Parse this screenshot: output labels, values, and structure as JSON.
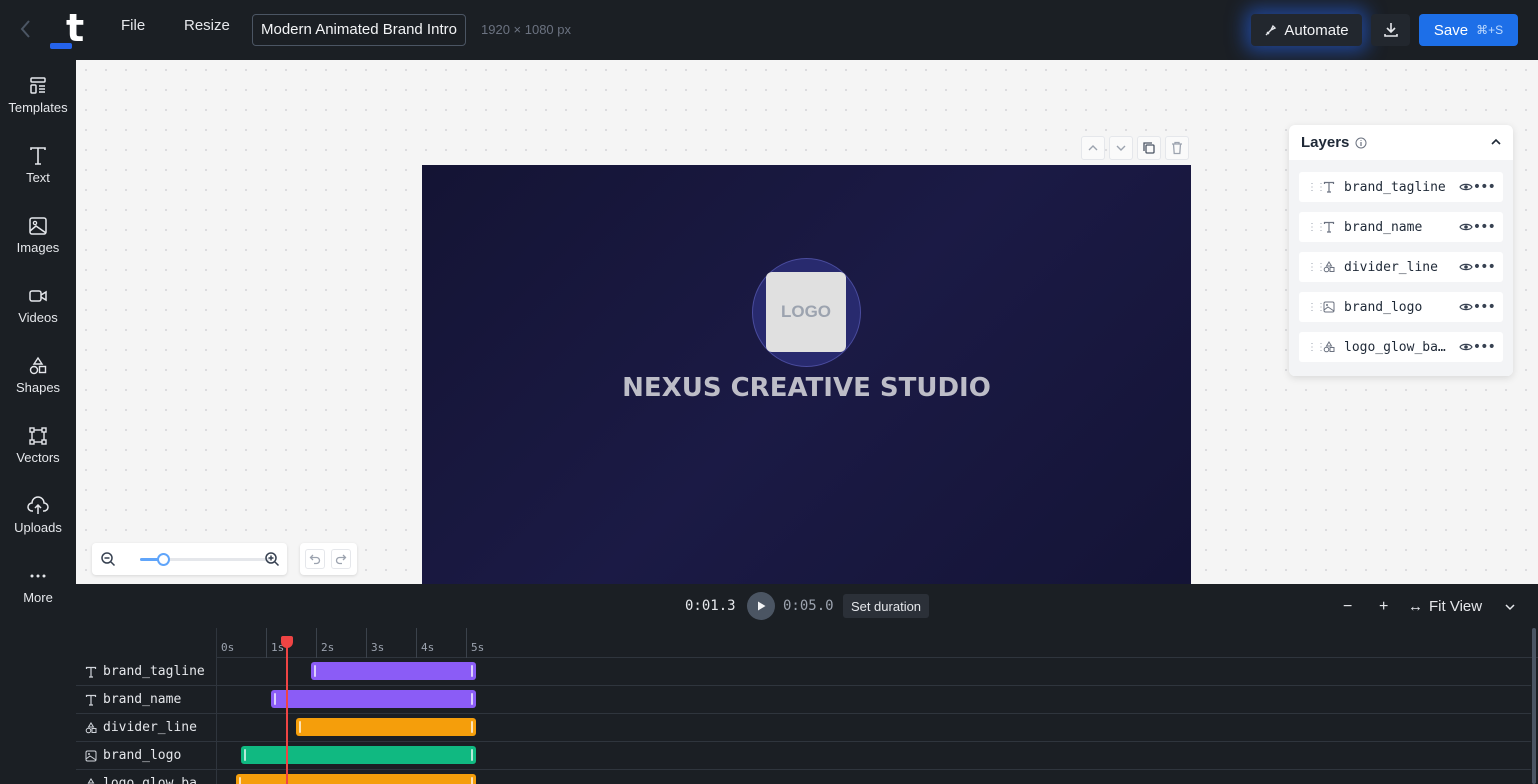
{
  "header": {
    "menu": {
      "file": "File",
      "resize": "Resize"
    },
    "project_title": "Modern Animated Brand Intro",
    "dimensions": "1920 × 1080 px",
    "automate_label": "Automate",
    "save_label": "Save",
    "save_shortcut": "⌘+S"
  },
  "sidebar": {
    "items": [
      {
        "label": "Templates",
        "icon": "templates-icon"
      },
      {
        "label": "Text",
        "icon": "text-icon"
      },
      {
        "label": "Images",
        "icon": "image-icon"
      },
      {
        "label": "Videos",
        "icon": "video-icon"
      },
      {
        "label": "Shapes",
        "icon": "shapes-icon"
      },
      {
        "label": "Vectors",
        "icon": "vector-icon"
      },
      {
        "label": "Uploads",
        "icon": "upload-icon"
      },
      {
        "label": "More",
        "icon": "more-icon"
      }
    ]
  },
  "canvas": {
    "logo_text": "LOGO",
    "brand_name": "NEXUS CREATIVE STUDIO",
    "zoom_fraction": 0.18
  },
  "layers": {
    "title": "Layers",
    "items": [
      {
        "name": "brand_tagline",
        "type": "text"
      },
      {
        "name": "brand_name",
        "type": "text"
      },
      {
        "name": "divider_line",
        "type": "shape"
      },
      {
        "name": "brand_logo",
        "type": "image"
      },
      {
        "name": "logo_glow_ba…",
        "type": "shape"
      }
    ]
  },
  "timeline": {
    "current_time": "0:01.3",
    "total_time": "0:05.0",
    "set_duration_label": "Set duration",
    "fit_view_label": "Fit View",
    "ruler_ticks": [
      "0s",
      "1s",
      "2s",
      "3s",
      "4s",
      "5s"
    ],
    "tracks": [
      {
        "name": "brand_tagline",
        "type": "text",
        "start": 1.7,
        "end": 5.0,
        "color": "#8b5cf6"
      },
      {
        "name": "brand_name",
        "type": "text",
        "start": 0.9,
        "end": 5.0,
        "color": "#8b5cf6"
      },
      {
        "name": "divider_line",
        "type": "shape",
        "start": 1.4,
        "end": 5.0,
        "color": "#f59e0b"
      },
      {
        "name": "brand_logo",
        "type": "image",
        "start": 0.3,
        "end": 5.0,
        "color": "#10b981"
      },
      {
        "name": "logo_glow_ba",
        "type": "shape",
        "start": 0.2,
        "end": 5.0,
        "color": "#f59e0b"
      }
    ],
    "playhead_seconds": 1.3
  },
  "colors": {
    "accent": "#1d6fe8",
    "text_clip": "#8b5cf6",
    "shape_clip": "#f59e0b",
    "image_clip": "#10b981",
    "playhead": "#ef4444"
  }
}
